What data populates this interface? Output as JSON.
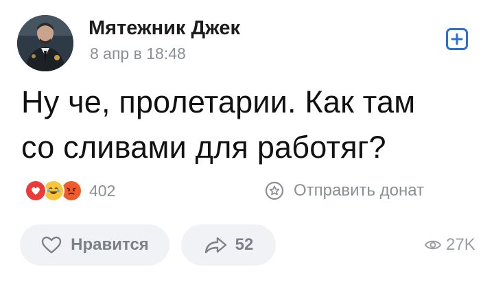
{
  "post": {
    "author_name": "Мятежник Джек",
    "time": "8 апр в 18:48",
    "text_line1": "Ну че, пролетарии. Как там",
    "text_line2": "со сливами для работяг?"
  },
  "reactions": {
    "icons": [
      "heart-reaction",
      "laugh-reaction",
      "angry-reaction"
    ],
    "count": "402"
  },
  "donate": {
    "label": "Отправить донат",
    "icon": "star-badge-icon"
  },
  "actions": {
    "like_label": "Нравится",
    "share_count": "52",
    "views": "27K"
  },
  "colors": {
    "accent": "#2a6fd6",
    "muted": "#8b8f94",
    "pill_bg": "#f0f2f5"
  }
}
